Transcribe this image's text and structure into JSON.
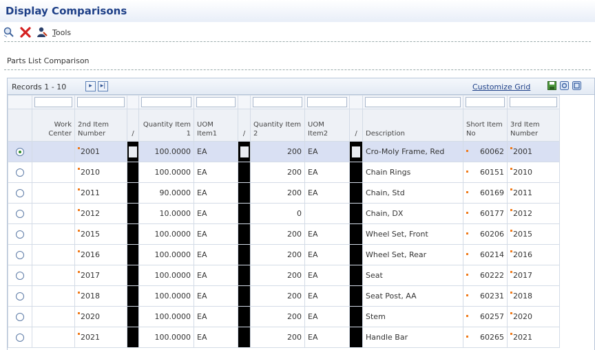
{
  "window": {
    "title": "Display Comparisons"
  },
  "toolbar": {
    "tools_label": "Tools",
    "tools_hotkey": "T",
    "tools_rest": "ools",
    "icons": [
      "find-icon",
      "close-icon",
      "tools-person-icon"
    ]
  },
  "section": {
    "label": "Parts List Comparison"
  },
  "grid": {
    "records_label": "Records 1 - 10",
    "customize_label": "Customize Grid",
    "columns": [
      {
        "label": "Work Center"
      },
      {
        "label": "2nd Item Number"
      },
      {
        "label": "/"
      },
      {
        "label": "Quantity Item 1"
      },
      {
        "label": "UOM Item1"
      },
      {
        "label": "/"
      },
      {
        "label": "Quantity Item 2"
      },
      {
        "label": "UOM Item2"
      },
      {
        "label": "/"
      },
      {
        "label": "Description"
      },
      {
        "label": "Short Item No"
      },
      {
        "label": "3rd Item Number"
      }
    ],
    "rows": [
      {
        "selected": true,
        "work_center": "",
        "item2": "2001",
        "qty1": "100.0000",
        "uom1": "EA",
        "qty2": "200",
        "uom2": "EA",
        "description": "Cro-Moly Frame, Red",
        "short_item": "60062",
        "item3": "2001"
      },
      {
        "selected": false,
        "work_center": "",
        "item2": "2010",
        "qty1": "100.0000",
        "uom1": "EA",
        "qty2": "200",
        "uom2": "EA",
        "description": "Chain Rings",
        "short_item": "60151",
        "item3": "2010"
      },
      {
        "selected": false,
        "work_center": "",
        "item2": "2011",
        "qty1": "90.0000",
        "uom1": "EA",
        "qty2": "200",
        "uom2": "EA",
        "description": "Chain, Std",
        "short_item": "60169",
        "item3": "2011"
      },
      {
        "selected": false,
        "work_center": "",
        "item2": "2012",
        "qty1": "10.0000",
        "uom1": "EA",
        "qty2": "0",
        "uom2": "",
        "description": "Chain, DX",
        "short_item": "60177",
        "item3": "2012"
      },
      {
        "selected": false,
        "work_center": "",
        "item2": "2015",
        "qty1": "100.0000",
        "uom1": "EA",
        "qty2": "200",
        "uom2": "EA",
        "description": "Wheel Set, Front",
        "short_item": "60206",
        "item3": "2015"
      },
      {
        "selected": false,
        "work_center": "",
        "item2": "2016",
        "qty1": "100.0000",
        "uom1": "EA",
        "qty2": "200",
        "uom2": "EA",
        "description": "Wheel Set, Rear",
        "short_item": "60214",
        "item3": "2016"
      },
      {
        "selected": false,
        "work_center": "",
        "item2": "2017",
        "qty1": "100.0000",
        "uom1": "EA",
        "qty2": "200",
        "uom2": "EA",
        "description": "Seat",
        "short_item": "60222",
        "item3": "2017"
      },
      {
        "selected": false,
        "work_center": "",
        "item2": "2018",
        "qty1": "100.0000",
        "uom1": "EA",
        "qty2": "200",
        "uom2": "EA",
        "description": "Seat Post, AA",
        "short_item": "60231",
        "item3": "2018"
      },
      {
        "selected": false,
        "work_center": "",
        "item2": "2020",
        "qty1": "100.0000",
        "uom1": "EA",
        "qty2": "200",
        "uom2": "EA",
        "description": "Stem",
        "short_item": "60257",
        "item3": "2020"
      },
      {
        "selected": false,
        "work_center": "",
        "item2": "2021",
        "qty1": "100.0000",
        "uom1": "EA",
        "qty2": "200",
        "uom2": "EA",
        "description": "Handle Bar",
        "short_item": "60265",
        "item3": "2021"
      }
    ]
  },
  "colors": {
    "title": "#1d3f87",
    "selected_row": "#d9e0f3",
    "flag": "#f07a1a",
    "radio_on": "#2e8b2e"
  }
}
